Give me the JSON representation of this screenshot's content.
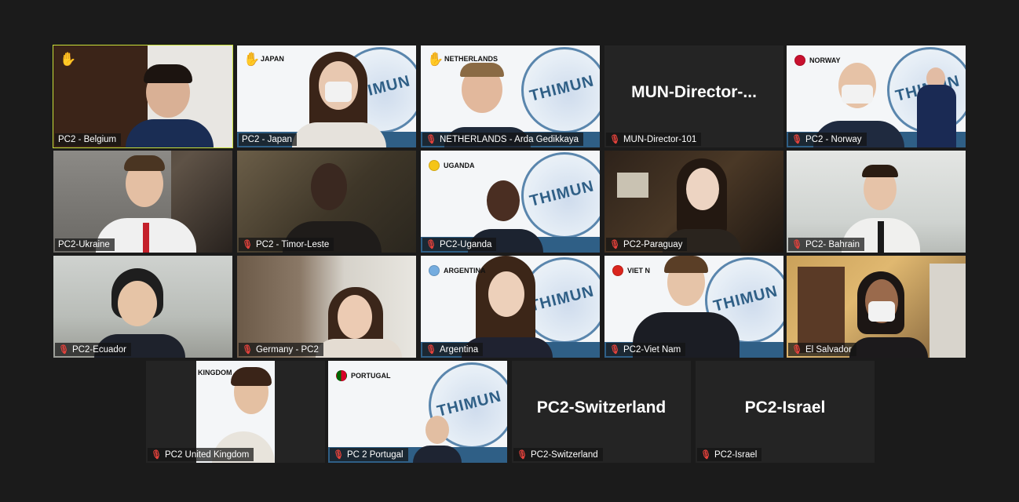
{
  "participants": [
    {
      "label": "PC2 - Belgium",
      "tag": "",
      "flag": "",
      "hand": true,
      "muted": false,
      "active": true
    },
    {
      "label": "PC2 - Japan",
      "tag": "JAPAN",
      "flag": "#f5c518",
      "hand": true,
      "muted": false
    },
    {
      "label": "NETHERLANDS - Arda Gedikkaya",
      "tag": "NETHERLANDS",
      "flag": "",
      "hand": true,
      "muted": true
    },
    {
      "label": "MUN-Director-101",
      "big": "MUN-Director-...",
      "muted": true
    },
    {
      "label": "PC2 - Norway",
      "tag": "NORWAY",
      "flag": "#c8102e",
      "muted": true
    },
    {
      "label": "PC2-Ukraine",
      "muted": false
    },
    {
      "label": "PC2 - Timor-Leste",
      "muted": true
    },
    {
      "label": "PC2-Uganda",
      "tag": "UGANDA",
      "flag": "#f5c518",
      "muted": true
    },
    {
      "label": "PC2-Paraguay",
      "muted": true
    },
    {
      "label": "PC2- Bahrain",
      "muted": true
    },
    {
      "label": "PC2-Ecuador",
      "muted": true
    },
    {
      "label": "Germany - PC2",
      "muted": true
    },
    {
      "label": "Argentina",
      "tag": "ARGENTINA",
      "flag": "#74acdf",
      "muted": true
    },
    {
      "label": "PC2-Viet Nam",
      "tag": "VIET N",
      "flag": "#da251d",
      "muted": true
    },
    {
      "label": "El Salvador",
      "muted": true
    },
    {
      "label": "PC2 United Kingdom",
      "tag": "KINGDOM",
      "muted": true
    },
    {
      "label": "PC 2 Portugal",
      "tag": "PORTUGAL",
      "flag": "#006600",
      "muted": true
    },
    {
      "label": "PC2-Switzerland",
      "big": "PC2-Switzerland",
      "muted": true
    },
    {
      "label": "PC2-Israel",
      "big": "PC2-Israel",
      "muted": true
    }
  ],
  "banner_text": "THIMUN",
  "icons": {
    "raised_hand": "raised-hand-icon",
    "mic_off": "mic-off-icon"
  },
  "colors": {
    "active_border": "#c8e03a",
    "muted_icon": "#e0413b",
    "thimun_blue": "#2f5f86"
  }
}
